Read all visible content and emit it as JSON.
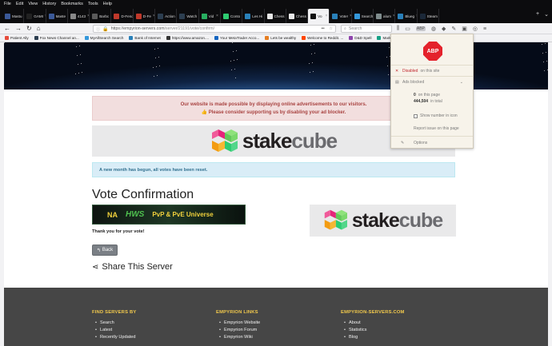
{
  "menubar": [
    "File",
    "Edit",
    "View",
    "History",
    "Bookmarks",
    "Tools",
    "Help"
  ],
  "tabs": [
    {
      "label": "Mastu"
    },
    {
      "label": "GAMI"
    },
    {
      "label": "Maste"
    },
    {
      "label": "4143"
    },
    {
      "label": "Barbc"
    },
    {
      "label": "D-Fend R"
    },
    {
      "label": "D-Fe"
    },
    {
      "label": "Action"
    },
    {
      "label": "Watch"
    },
    {
      "label": "Vid"
    },
    {
      "label": "Conto"
    },
    {
      "label": "Les Hi"
    },
    {
      "label": "Chess"
    },
    {
      "label": "Chess"
    },
    {
      "label": "Vo",
      "active": true
    },
    {
      "label": "Vote!"
    },
    {
      "label": "Search"
    },
    {
      "label": "alum"
    },
    {
      "label": "Blueg"
    },
    {
      "label": "Steam"
    }
  ],
  "url": {
    "host": "https://empyrion-servers.com",
    "path": "/server/21191/vote/confirm/"
  },
  "search_placeholder": "Search",
  "bookmarks": [
    "Patient Ally",
    "Fox News Channel an...",
    "MyAllSearch Search",
    "Bank of Internet",
    "https://www.amazon....",
    "Your MetaTrader Acco...",
    "Lets be wealthy",
    "Welcome to Reddit. ...",
    "D&D Spell",
    "Market Traders Institut..."
  ],
  "alert_red": {
    "line1": "Our website is made possible by displaying online advertisements to our visitors.",
    "line2": "Please consider supporting us by disabling your ad blocker."
  },
  "logo": {
    "part1": "stake",
    "part2": "cube"
  },
  "alert_blue": "A new month has begun, all votes have been reset.",
  "vote_title": "Vote Confirmation",
  "server_banner": {
    "na": "NA",
    "hws": "HWS",
    "tagline": "PvP & PvE Universe"
  },
  "thanks": "Thank you for your vote!",
  "back_label": "Back",
  "share_label": "Share This Server",
  "footer": {
    "col1": {
      "title": "FIND SERVERS BY",
      "items": [
        "Search",
        "Latest",
        "Recently Updated"
      ]
    },
    "col2": {
      "title": "EMPYRION LINKS",
      "items": [
        "Empyrion Website",
        "Empyrion Forum",
        "Empyrion Wiki"
      ]
    },
    "col3": {
      "title": "EMPYRION-SERVERS.COM",
      "items": [
        "About",
        "Statistics",
        "Blog"
      ]
    }
  },
  "abp": {
    "badge": "ABP",
    "disabled_label": "Disabled",
    "disabled_suffix": "on this site",
    "ads_blocked": "Ads blocked",
    "on_page_count": "0",
    "on_page_label": "on this page",
    "total_count": "444,504",
    "total_label": "in total",
    "show_number": "Show number in icon",
    "report": "Report issue on this page",
    "options": "Options"
  }
}
